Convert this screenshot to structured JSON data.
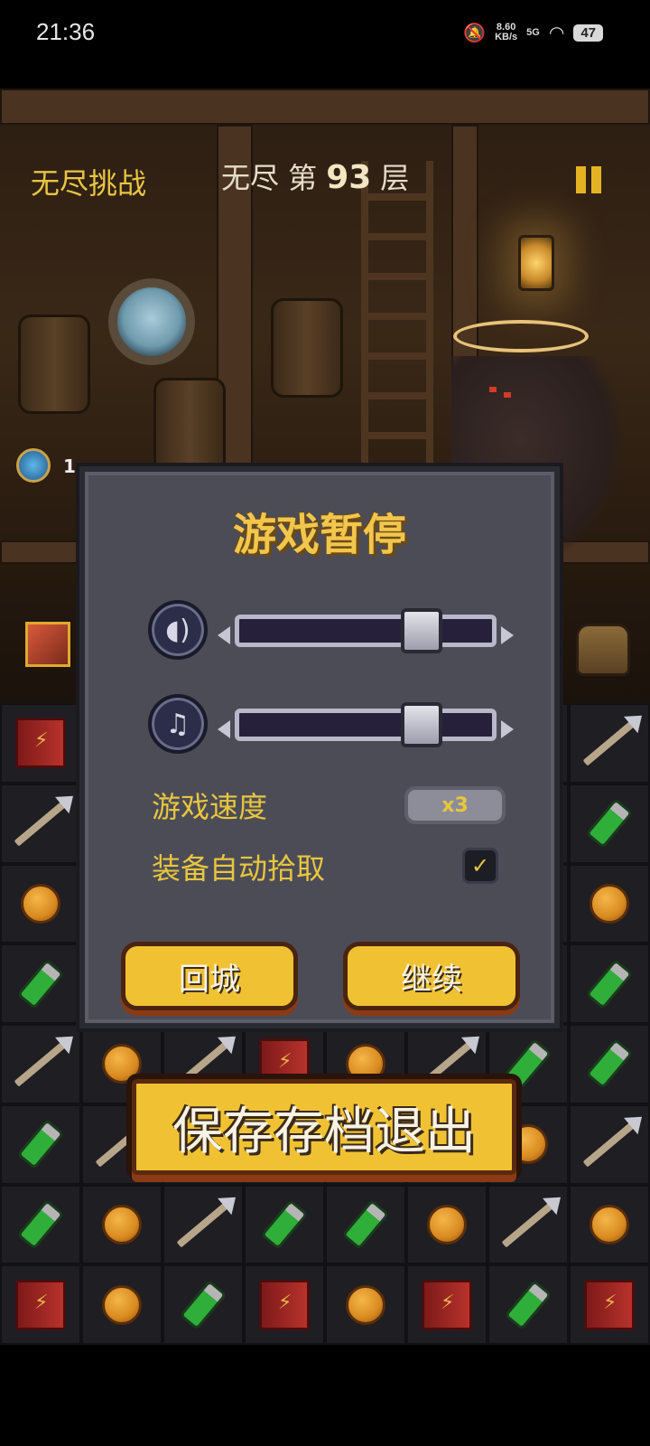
{
  "status_bar": {
    "time": "21:36",
    "net_speed_value": "8.60",
    "net_speed_unit": "KB/s",
    "signal_label": "5G",
    "battery": "47",
    "icons": [
      "mute-bell-icon",
      "signal-icon",
      "wifi-icon",
      "battery-icon"
    ]
  },
  "hud": {
    "mode_label": "无尽挑战",
    "floor_prefix": "无尽 第",
    "floor_number": "93",
    "floor_suffix": "层",
    "skill_value": "1"
  },
  "pause_dialog": {
    "title": "游戏暂停",
    "sound_volume": 0.72,
    "music_volume": 0.72,
    "speed_label": "游戏速度",
    "speed_value": "x3",
    "auto_pickup_label": "装备自动拾取",
    "auto_pickup_checked": true,
    "return_town_label": "回城",
    "continue_label": "继续"
  },
  "save_exit_label": "保存存档退出",
  "grid": {
    "rows": [
      [
        "book",
        "",
        "",
        "",
        "",
        "",
        "",
        "arrow"
      ],
      [
        "arrow",
        "",
        "",
        "",
        "",
        "",
        "",
        "potion"
      ],
      [
        "coin",
        "",
        "",
        "",
        "",
        "",
        "",
        "coin"
      ],
      [
        "potion",
        "",
        "",
        "",
        "",
        "",
        "",
        "potion"
      ],
      [
        "arrow",
        "coin",
        "arrow",
        "book",
        "coin",
        "arrow",
        "potion",
        "potion"
      ],
      [
        "potion",
        "arrow",
        "",
        "",
        "",
        "",
        "coin",
        "arrow"
      ],
      [
        "potion",
        "coin",
        "arrow",
        "potion",
        "potion",
        "coin",
        "arrow",
        "coin"
      ],
      [
        "book",
        "coin",
        "potion",
        "book",
        "coin",
        "book",
        "potion",
        "book"
      ]
    ]
  },
  "colors": {
    "gold": "#f0c233",
    "label_yellow": "#e8c63f",
    "dialog_bg": "#4c4c57"
  }
}
